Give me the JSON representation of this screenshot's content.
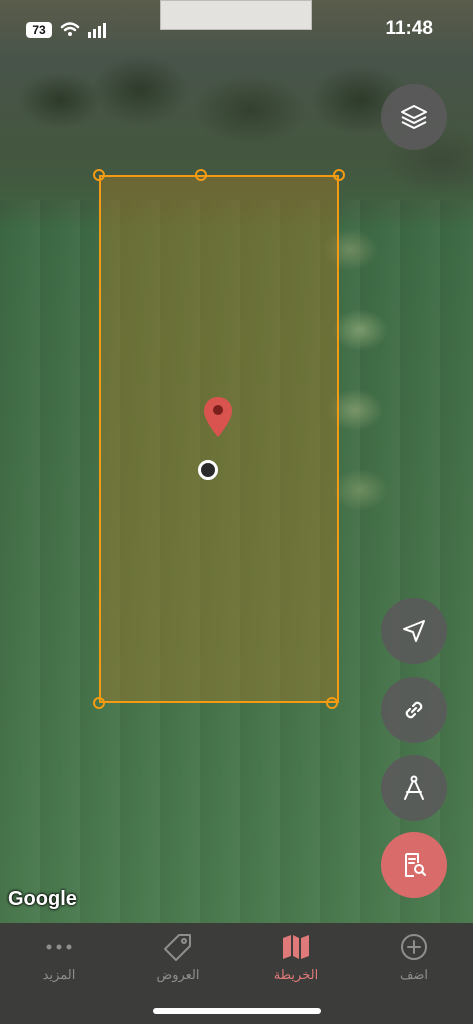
{
  "status_bar": {
    "battery": "73",
    "time": "11:48"
  },
  "map": {
    "attribution": "Google",
    "plot_color": "#f39b12",
    "pin_color": "#d9534f"
  },
  "buttons": {
    "layers": "layers-icon",
    "locate": "navigation-arrow-icon",
    "share": "link-icon",
    "measure": "compass-icon",
    "report": "document-search-icon"
  },
  "tabs": [
    {
      "label": "المزيد",
      "icon": "more-dots-icon"
    },
    {
      "label": "العروض",
      "icon": "tag-icon"
    },
    {
      "label": "الخريطة",
      "icon": "map-icon",
      "active": true
    },
    {
      "label": "اضف",
      "icon": "add-circle-icon"
    }
  ],
  "colors": {
    "accent": "#e07a7a",
    "tab_inactive": "#8e8e8e",
    "tabbar_bg": "#3c3c3a"
  }
}
